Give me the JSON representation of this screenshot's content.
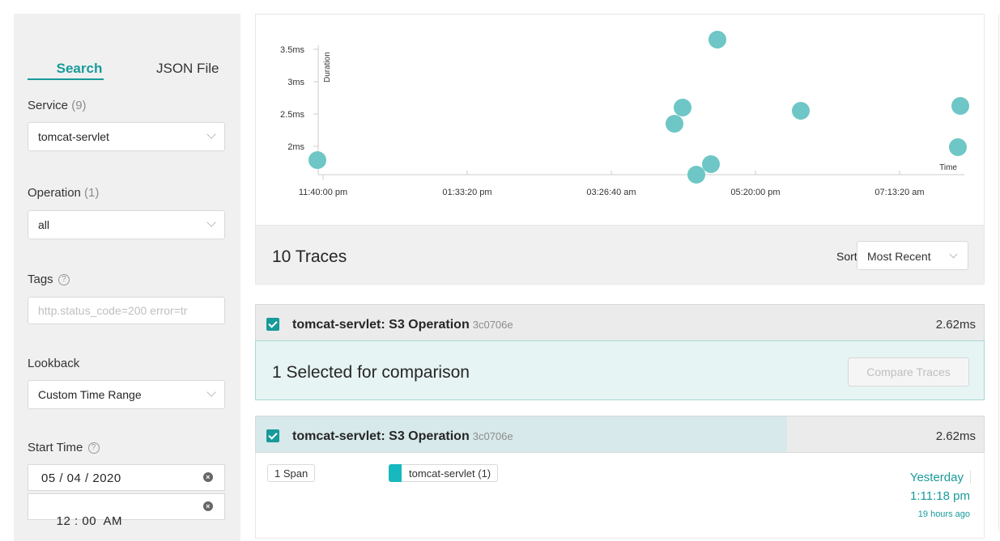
{
  "sidebar": {
    "tabs": [
      {
        "label": "Search",
        "active": true
      },
      {
        "label": "JSON File",
        "active": false
      }
    ],
    "service": {
      "label": "Service",
      "count": "(9)",
      "value": "tomcat-servlet"
    },
    "operation": {
      "label": "Operation",
      "count": "(1)",
      "value": "all"
    },
    "tags": {
      "label": "Tags",
      "placeholder": "http.status_code=200 error=tr"
    },
    "lookback": {
      "label": "Lookback",
      "value": "Custom Time Range"
    },
    "start_time": {
      "label": "Start Time",
      "date": "05 / 04 / 2020",
      "time": "12 : 00  AM"
    }
  },
  "chart": {
    "y_ticks": [
      "3.5ms",
      "3ms",
      "2.5ms",
      "2ms"
    ],
    "y_label": "Duration",
    "x_ticks": [
      "11:40:00 pm",
      "01:33:20 pm",
      "03:26:40 am",
      "05:20:00 pm",
      "07:13:20 am"
    ],
    "x_label": "Time",
    "point_color": "#6ec6c6"
  },
  "traces_header": {
    "title": "10 Traces",
    "sort_label": "Sort:",
    "sort_value": "Most Recent"
  },
  "trace_row_1": {
    "name": "tomcat-servlet: S3 Operation",
    "id": "3c0706e",
    "duration": "2.62ms"
  },
  "compare": {
    "text": "1 Selected for comparison",
    "button": "Compare Traces"
  },
  "trace_row_2": {
    "name": "tomcat-servlet: S3 Operation",
    "id": "3c0706e",
    "duration": "2.62ms",
    "span_count": "1 Span",
    "service_tag": "tomcat-servlet (1)",
    "date": "Yesterday",
    "time": "1:11:18 pm",
    "ago": "19 hours ago"
  },
  "colors": {
    "accent": "#199a9a",
    "service_swatch": "#17b8be",
    "sidebar_bg": "#f0f0f0"
  }
}
